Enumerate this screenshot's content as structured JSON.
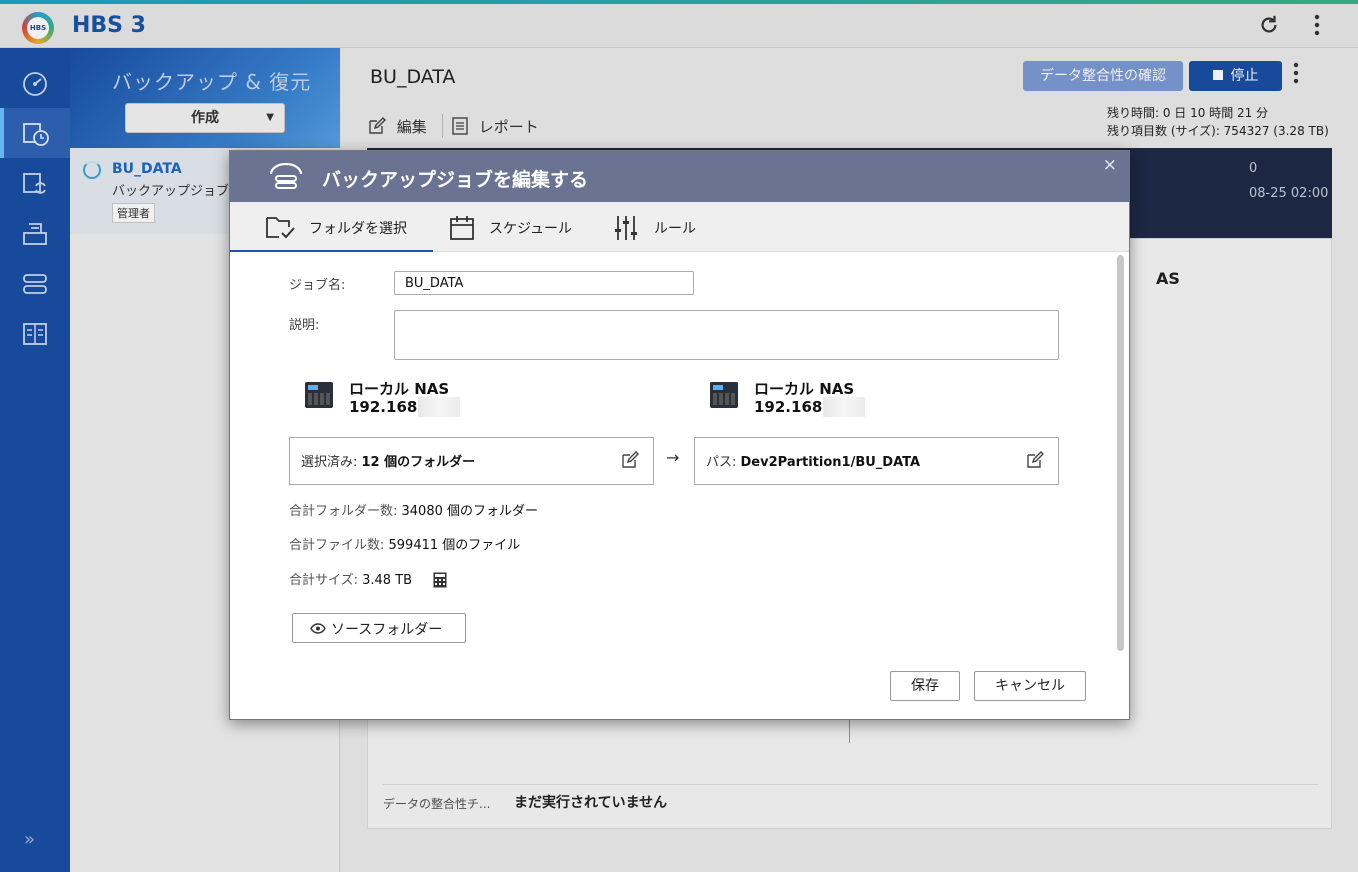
{
  "app": {
    "title": "HBS 3",
    "logo_text": "HBS"
  },
  "sidebar": {
    "items": [
      {
        "name": "overview",
        "icon": "dashboard-icon"
      },
      {
        "name": "backup-restore",
        "icon": "backup-restore-icon",
        "active": true
      },
      {
        "name": "sync",
        "icon": "sync-icon"
      },
      {
        "name": "storage",
        "icon": "storage-icon"
      },
      {
        "name": "services",
        "icon": "services-icon"
      },
      {
        "name": "logs",
        "icon": "logs-icon"
      }
    ],
    "expand_label": "»"
  },
  "left_panel": {
    "title": "バックアップ & 復元",
    "create_label": "作成",
    "job": {
      "name": "BU_DATA",
      "subtitle": "バックアップジョブ",
      "badge": "管理者"
    }
  },
  "main": {
    "title": "BU_DATA",
    "verify_label": "データ整合性の確認",
    "stop_label": "停止",
    "remaining_time": "残り時間: 0 日 10 時間 21 分",
    "remaining_items": "残り項目数 (サイズ): 754327 (3.28 TB)",
    "edit_label": "編集",
    "report_label": "レポート",
    "dark_small": "0",
    "dark_date": "08-25 02:00",
    "nas_fragment": "AS",
    "integrity_label": "データの整合性チ...",
    "integrity_value": "まだ実行されていません"
  },
  "dialog": {
    "title": "バックアップジョブを編集する",
    "close": "×",
    "tabs": [
      {
        "label": "フォルダを選択",
        "icon": "folder-select-icon",
        "active": true
      },
      {
        "label": "スケジュール",
        "icon": "calendar-icon"
      },
      {
        "label": "ルール",
        "icon": "sliders-icon"
      }
    ],
    "job_name_label": "ジョブ名:",
    "job_name_value": "BU_DATA",
    "description_label": "説明:",
    "description_value": "",
    "source": {
      "name": "ローカル NAS",
      "ip": "192.168."
    },
    "destination": {
      "name": "ローカル NAS",
      "ip": "192.168."
    },
    "selected_prefix": "選択済み: ",
    "selected_value": "12 個のフォルダー",
    "path_prefix": "パス: ",
    "path_value": "Dev2Partition1/BU_DATA",
    "arrow": "→",
    "total_folders_label": "合計フォルダー数: ",
    "total_folders_value": "34080 個のフォルダー",
    "total_files_label": "合計ファイル数: ",
    "total_files_value": "599411 個のファイル",
    "total_size_label": "合計サイズ: ",
    "total_size_value": "3.48 TB",
    "source_folder_label": "ソースフォルダー",
    "save_label": "保存",
    "cancel_label": "キャンセル"
  }
}
